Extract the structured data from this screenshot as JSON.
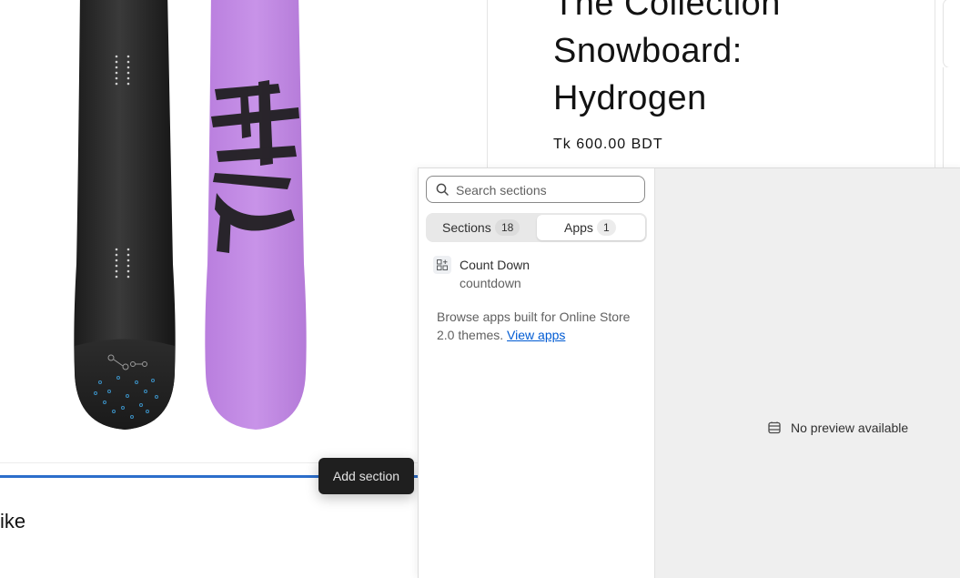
{
  "product": {
    "title_line1": "The Collection",
    "title_line2": "Snowboard:",
    "title_line3": "Hydrogen",
    "price": "Tk 600.00 BDT"
  },
  "preview_below": {
    "partial_heading": "ike"
  },
  "insert_tooltip": {
    "label": "Add section"
  },
  "popover": {
    "search": {
      "placeholder": "Search sections",
      "value": ""
    },
    "tabs": [
      {
        "label": "Sections",
        "count": "18",
        "active": false
      },
      {
        "label": "Apps",
        "count": "1",
        "active": true
      }
    ],
    "apps": [
      {
        "name": "Count Down",
        "handle": "countdown"
      }
    ],
    "browse": {
      "text": "Browse apps built for Online Store 2.0 themes.",
      "link_label": "View apps"
    },
    "preview": {
      "empty_label": "No preview available"
    }
  },
  "icons": {
    "search": "search-icon",
    "app_block": "app-block-icon",
    "no_preview": "no-preview-icon"
  },
  "colors": {
    "insert_line": "#2c6ecb",
    "link": "#005bd3",
    "board_purple": "#c28ce3",
    "tooltip_bg": "#1f1f1f"
  }
}
